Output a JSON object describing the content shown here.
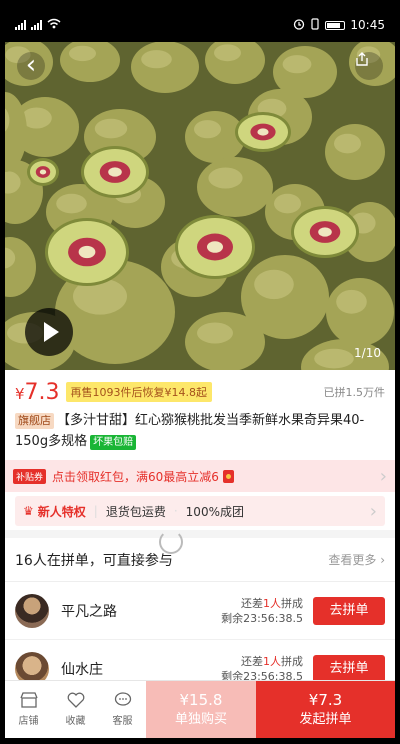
{
  "status_bar": {
    "carrier": "ᵘ",
    "icons": [
      "signal-icon",
      "wifi-icon",
      "alarm-icon",
      "battery-icon"
    ],
    "time": "10:45"
  },
  "hero": {
    "page_indicator": "1/10"
  },
  "product": {
    "price_symbol": "¥",
    "price": "7.3",
    "promo": "再售1093件后恢复¥14.8起",
    "sold": "已拼1.5万件",
    "shop_tag": "旗舰店",
    "title": "【多汁甘甜】红心猕猴桃批发当季新鲜水果奇异果40-150g多规格",
    "ship_tag": "坏果包赔"
  },
  "coupon": {
    "badge": "补贴券",
    "text": "点击领取红包，满60最高立减6"
  },
  "new_user": {
    "title": "新人特权",
    "item1": "退货包运费",
    "item2": "100%成团"
  },
  "group_buy": {
    "header": "16人在拼单，可直接参与",
    "more": "查看更多",
    "rows": [
      {
        "name": "平凡之路",
        "need_prefix": "还差",
        "need_count": "1人",
        "need_suffix": "拼成",
        "time_left": "剩余23:56:38.5",
        "button": "去拼单"
      },
      {
        "name": "仙水庄",
        "need_prefix": "还差",
        "need_count": "1人",
        "need_suffix": "拼成",
        "time_left": "剩余23:56:38.5",
        "button": "去拼单"
      }
    ]
  },
  "bottom_bar": {
    "nav": [
      {
        "label": "店铺",
        "icon": "store-icon"
      },
      {
        "label": "收藏",
        "icon": "heart-icon"
      },
      {
        "label": "客服",
        "icon": "chat-icon"
      }
    ],
    "solo": {
      "price": "¥15.8",
      "label": "单独购买"
    },
    "group": {
      "price": "¥7.3",
      "label": "发起拼单"
    }
  },
  "colors": {
    "accent": "#e5302a",
    "solo_button": "#f7bcb7",
    "promo_tag": "#fde76a",
    "ship_tag": "#19b535"
  }
}
